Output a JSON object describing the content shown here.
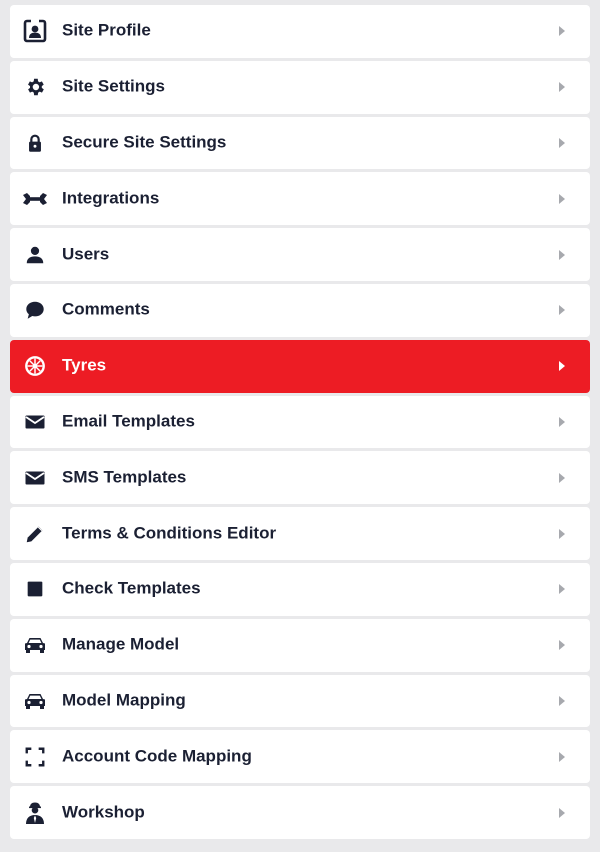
{
  "colors": {
    "background": "#e9e9eb",
    "item_background": "#ffffff",
    "active_background": "#ed1c24",
    "text": "#1b2033",
    "active_text": "#ffffff",
    "chevron": "#a7a9ae"
  },
  "menu": {
    "items": [
      {
        "label": "Site Profile",
        "icon": "id-badge-icon",
        "active": false
      },
      {
        "label": "Site Settings",
        "icon": "gear-icon",
        "active": false
      },
      {
        "label": "Secure Site Settings",
        "icon": "lock-icon",
        "active": false
      },
      {
        "label": "Integrations",
        "icon": "wrench-icon",
        "active": false
      },
      {
        "label": "Users",
        "icon": "user-icon",
        "active": false
      },
      {
        "label": "Comments",
        "icon": "comment-icon",
        "active": false
      },
      {
        "label": "Tyres",
        "icon": "tyre-icon",
        "active": true
      },
      {
        "label": "Email Templates",
        "icon": "envelope-icon",
        "active": false
      },
      {
        "label": "SMS Templates",
        "icon": "envelope-icon",
        "active": false
      },
      {
        "label": "Terms & Conditions Editor",
        "icon": "pencil-icon",
        "active": false
      },
      {
        "label": "Check Templates",
        "icon": "square-icon",
        "active": false
      },
      {
        "label": "Manage Model",
        "icon": "car-icon",
        "active": false
      },
      {
        "label": "Model Mapping",
        "icon": "car-icon",
        "active": false
      },
      {
        "label": "Account Code Mapping",
        "icon": "scan-frame-icon",
        "active": false
      },
      {
        "label": "Workshop",
        "icon": "mechanic-icon",
        "active": false
      }
    ]
  }
}
